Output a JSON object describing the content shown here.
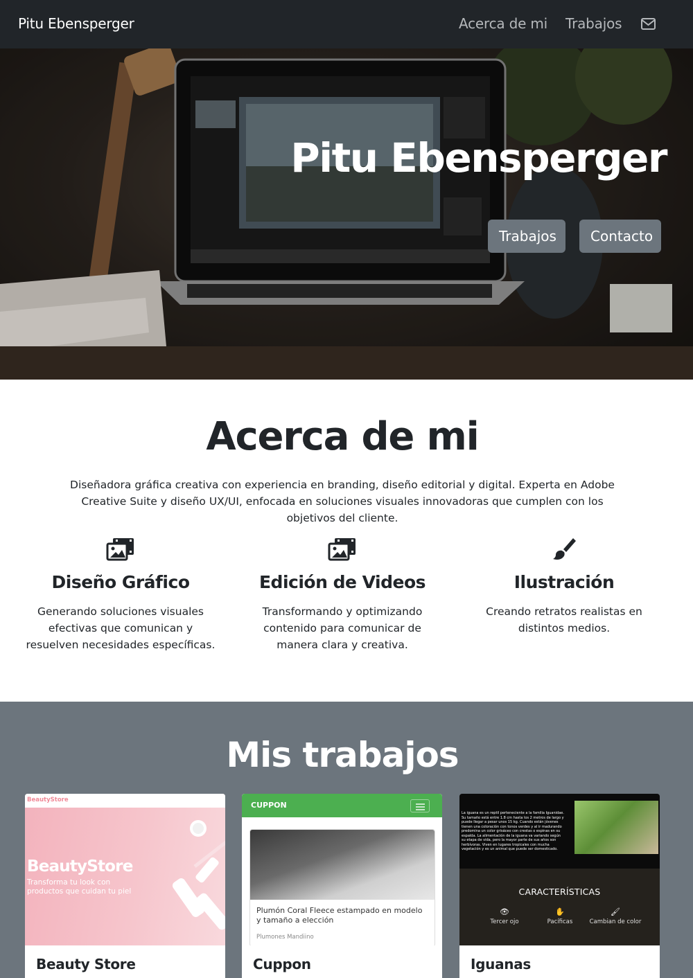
{
  "navbar": {
    "brand": "Pitu Ebensperger",
    "links": [
      "Acerca de mi",
      "Trabajos"
    ],
    "mail_icon": "envelope-icon"
  },
  "hero": {
    "title": "Pitu Ebensperger",
    "buttons": [
      "Trabajos",
      "Contacto"
    ]
  },
  "about": {
    "title": "Acerca de mi",
    "text": "Diseñadora gráfica creativa con experiencia en branding, diseño editorial y digital. Experta en Adobe Creative Suite y diseño UX/UI, enfocada en soluciones visuales innovadoras que cumplen con los objetivos del cliente.",
    "features": [
      {
        "icon": "photo-film-icon",
        "title": "Diseño Gráfico",
        "text": "Generando soluciones visuales efectivas que comunican y resuelven necesidades específicas."
      },
      {
        "icon": "photo-film-icon",
        "title": "Edición de Videos",
        "text": "Transformando y optimizando contenido para comunicar de manera clara y creativa."
      },
      {
        "icon": "paintbrush-icon",
        "title": "Ilustración",
        "text": "Creando retratos realistas en distintos medios."
      }
    ]
  },
  "works": {
    "title": "Mis trabajos",
    "cards": [
      {
        "title": "Beauty Store",
        "thumb": {
          "header": "BeautyStore",
          "name": "BeautyStore",
          "sub": "Transforma tu look con productos que cuidan tu piel"
        }
      },
      {
        "title": "Cuppon",
        "thumb": {
          "header": "CUPPON",
          "caption": "Plumón Coral Fleece estampado en modelo y tamaño a elección",
          "small": "Plumones Mandiino"
        }
      },
      {
        "title": "Iguanas",
        "thumb": {
          "text": "La iguana es un reptil perteneciente a la familia Iguanidae. Su tamaño está entre 1.8 cm hasta los 2 metros de largo y puede llegar a pesar unos 15 kg. Cuando están jóvenes tienen una coloración con tonos verdes y al ir madurando predomina un color grisáceo con crestas o espinas en su espalda. La alimentación de la iguana va variando según su etapa de vida, pero la mayor parte de sus años son herbívoras. Viven en lugares tropicales con mucha vegetación y es un animal que puede ser domesticado.",
          "heading": "CARACTERÍSTICAS",
          "features": [
            "Tercer ojo",
            "Pacíficas",
            "Cambian de color"
          ]
        }
      }
    ]
  }
}
